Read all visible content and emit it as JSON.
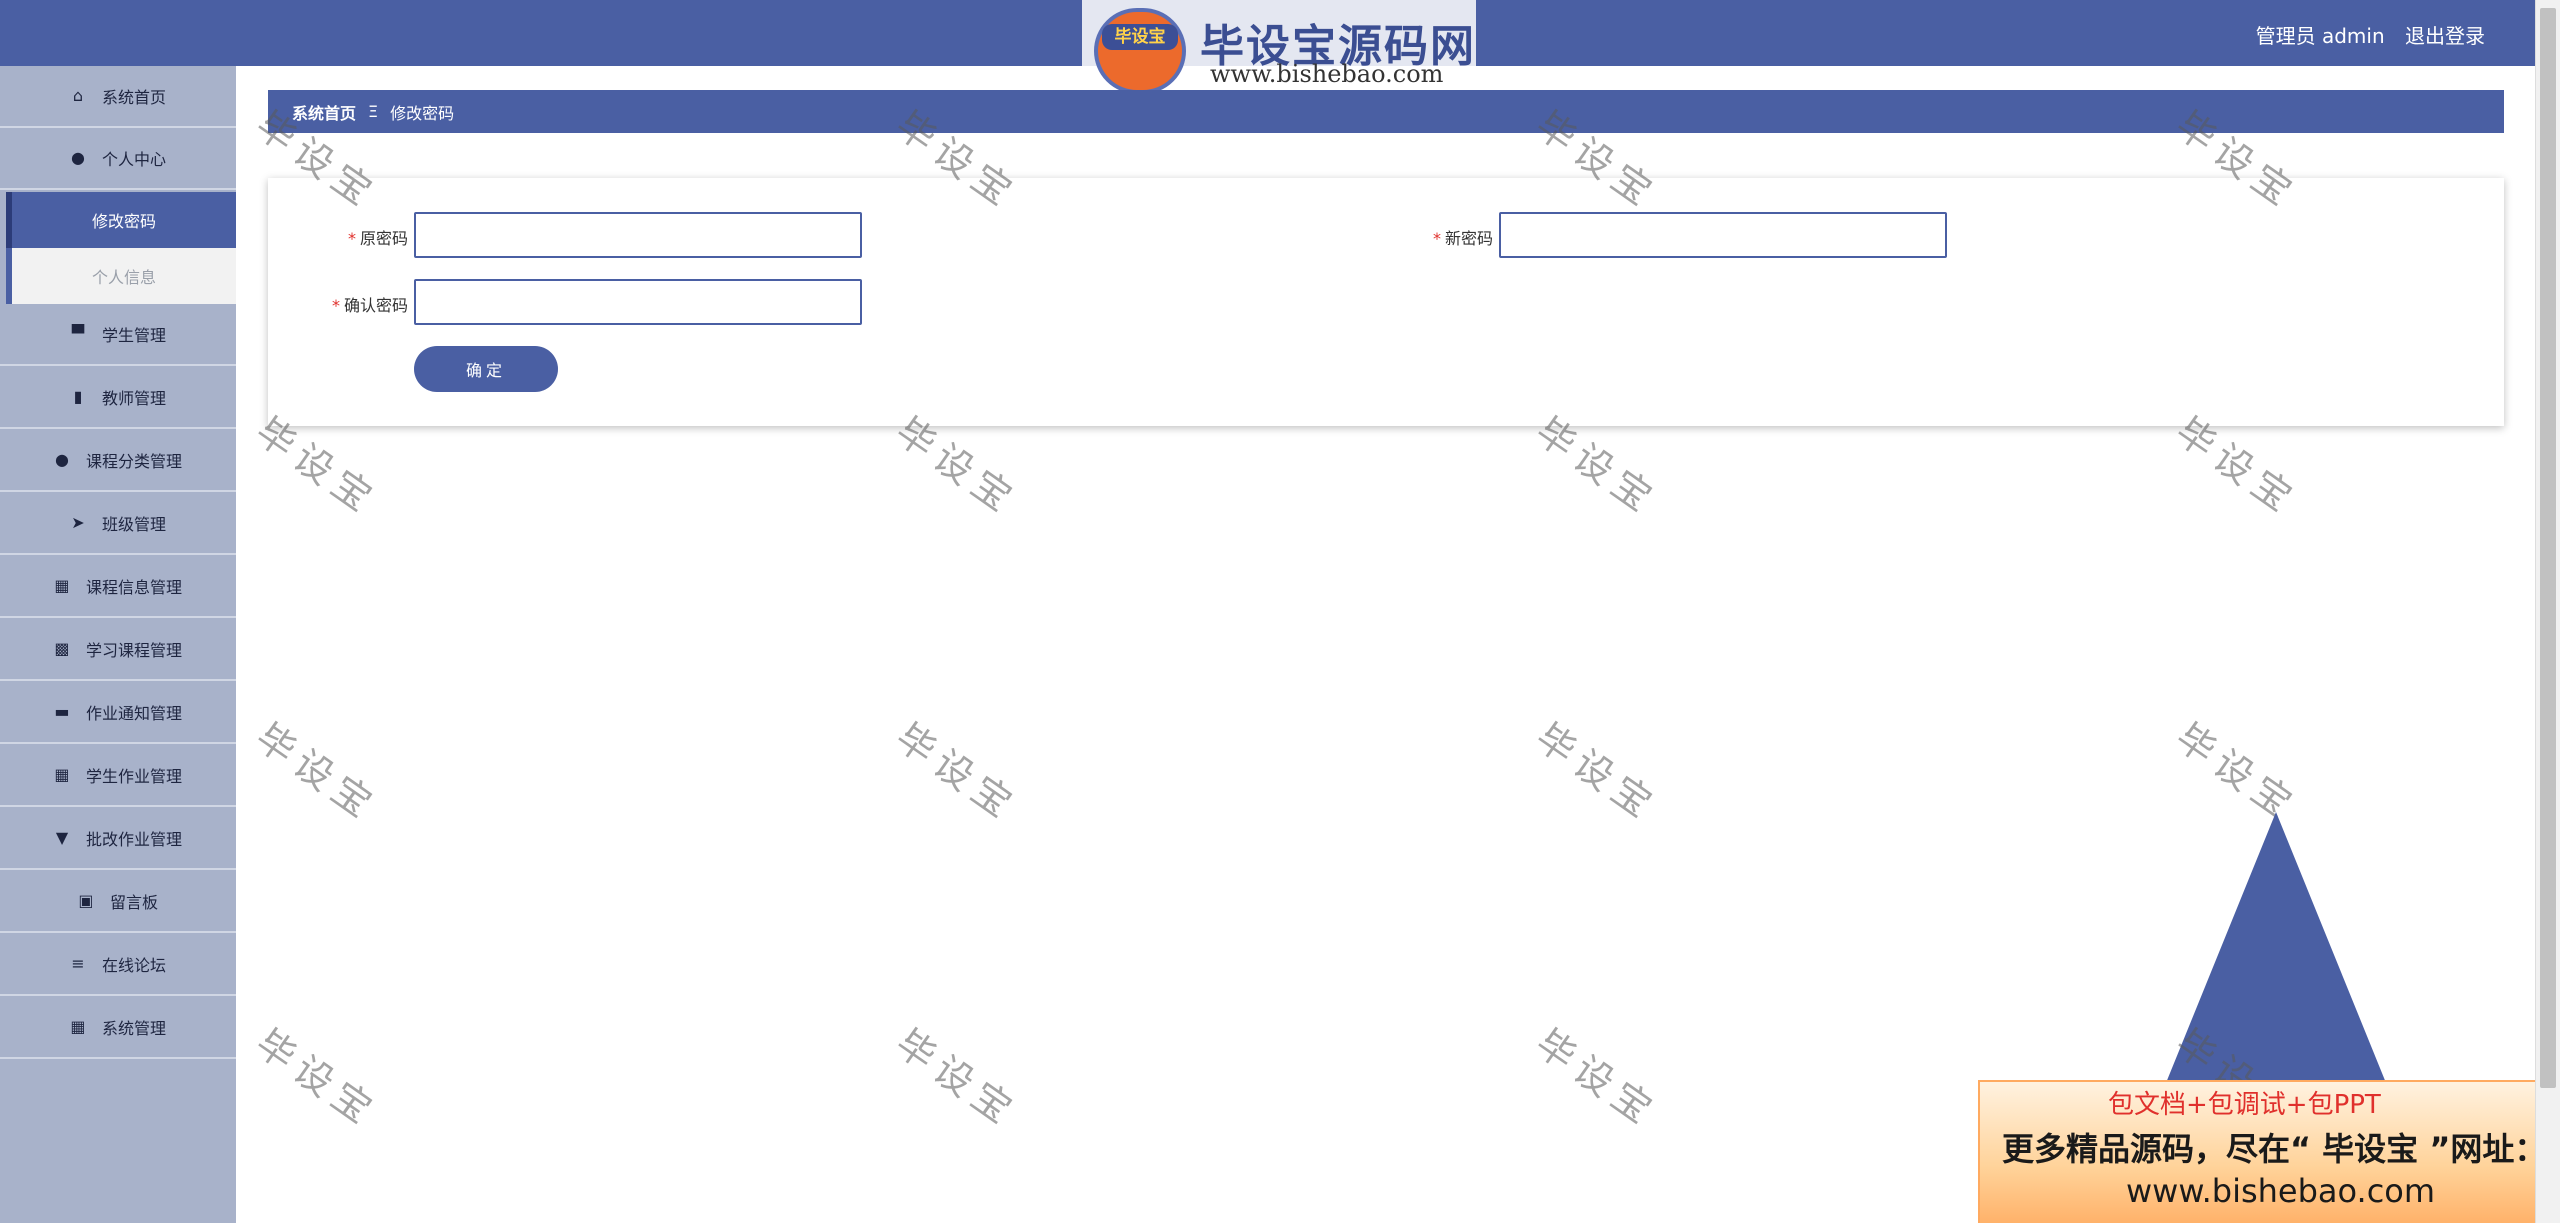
{
  "header": {
    "user_label": "管理员 admin",
    "logout_label": "退出登录",
    "logo_badge": "毕设宝",
    "logo_title": "毕设宝源码网",
    "logo_url": "www.bishebao.com"
  },
  "sidebar": {
    "items": [
      {
        "label": "系统首页",
        "icon": "home-icon"
      },
      {
        "label": "个人中心",
        "icon": "user-icon"
      },
      {
        "label": "学生管理",
        "icon": "comment-icon"
      },
      {
        "label": "教师管理",
        "icon": "book-icon"
      },
      {
        "label": "课程分类管理",
        "icon": "user-icon"
      },
      {
        "label": "班级管理",
        "icon": "send-icon"
      },
      {
        "label": "课程信息管理",
        "icon": "grid-icon"
      },
      {
        "label": "学习课程管理",
        "icon": "apps-icon"
      },
      {
        "label": "作业通知管理",
        "icon": "ticket-icon"
      },
      {
        "label": "学生作业管理",
        "icon": "grid-icon"
      },
      {
        "label": "批改作业管理",
        "icon": "stamp-icon"
      },
      {
        "label": "留言板",
        "icon": "clipboard-icon"
      },
      {
        "label": "在线论坛",
        "icon": "list-icon"
      },
      {
        "label": "系统管理",
        "icon": "grid-icon"
      }
    ],
    "sub_items": [
      {
        "label": "修改密码",
        "active": true
      },
      {
        "label": "个人信息",
        "active": false
      }
    ]
  },
  "breadcrumb": {
    "home": "系统首页",
    "separator": "Ξ",
    "current": "修改密码"
  },
  "form": {
    "required_mark": "*",
    "old_password_label": "原密码",
    "new_password_label": "新密码",
    "confirm_password_label": "确认密码",
    "old_password_value": "",
    "new_password_value": "",
    "confirm_password_value": "",
    "submit_label": "确定"
  },
  "watermark": "毕设宝",
  "ad": {
    "line1": "包文档+包调试+包PPT",
    "line2": "更多精品源码，尽在“ 毕设宝 ”网址：",
    "line3": "www.bishebao.com"
  },
  "colors": {
    "primary": "#4a5fa3",
    "sidebar_bg": "#a8b2ca",
    "required": "#e0302c"
  }
}
